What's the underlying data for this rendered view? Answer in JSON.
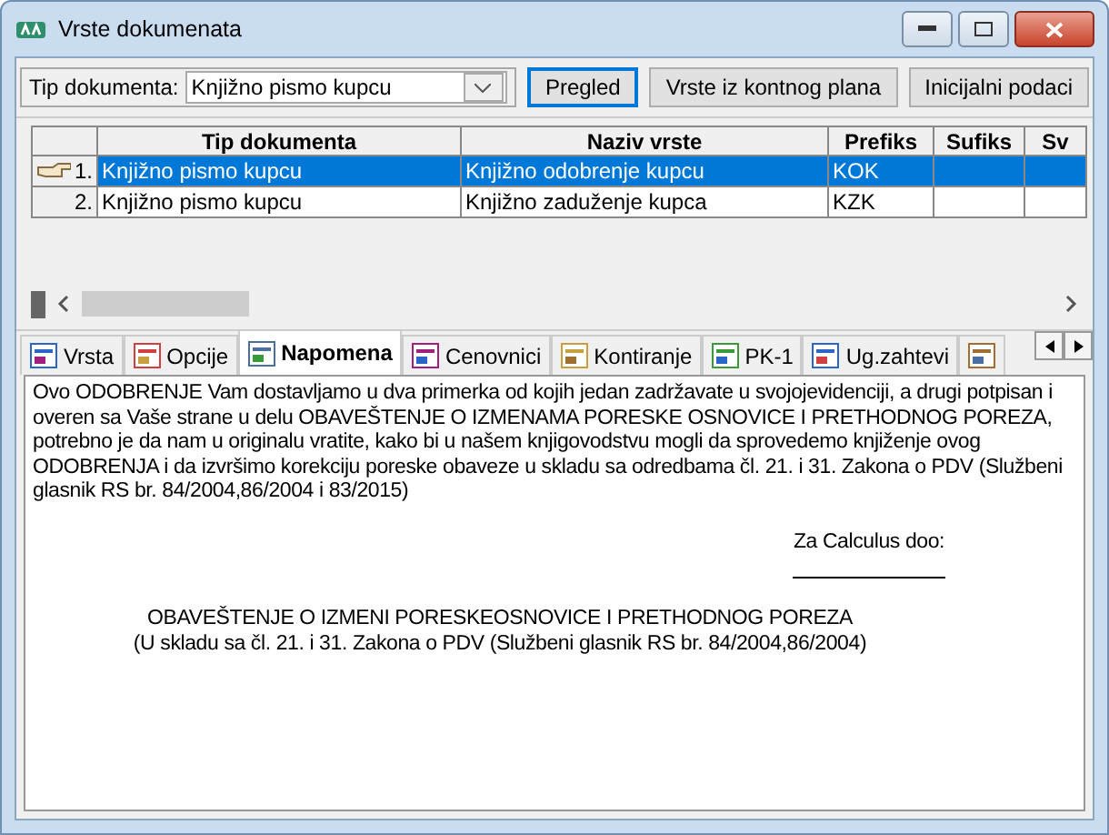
{
  "window": {
    "title": "Vrste dokumenata"
  },
  "toolbar": {
    "filter_label": "Tip dokumenta:",
    "filter_value": "Knjižno pismo kupcu",
    "buttons": [
      {
        "label": "Pregled",
        "selected": true
      },
      {
        "label": "Vrste iz kontnog plana",
        "selected": false
      },
      {
        "label": "Inicijalni podaci",
        "selected": false
      }
    ]
  },
  "table": {
    "columns": [
      "Tip dokumenta",
      "Naziv vrste",
      "Prefiks",
      "Sufiks",
      "Sv"
    ],
    "rows": [
      {
        "number": "1.",
        "selected": true,
        "cells": [
          "Knjižno pismo kupcu",
          "Knjižno odobrenje kupcu",
          "KOK",
          "",
          ""
        ]
      },
      {
        "number": "2.",
        "selected": false,
        "cells": [
          "Knjižno pismo kupcu",
          "Knjižno zaduženje kupca",
          "KZK",
          "",
          ""
        ]
      }
    ]
  },
  "tabs": [
    {
      "label": "Vrsta",
      "selected": false
    },
    {
      "label": "Opcije",
      "selected": false
    },
    {
      "label": "Napomena",
      "selected": true
    },
    {
      "label": "Cenovnici",
      "selected": false
    },
    {
      "label": "Kontiranje",
      "selected": false
    },
    {
      "label": "PK-1",
      "selected": false
    },
    {
      "label": "Ug.zahtevi",
      "selected": false
    },
    {
      "selected": false
    }
  ],
  "note": {
    "paragraph": "Ovo ODOBRENJE Vam dostavljamo u dva primerka od kojih jedan zadržavate u svojojevidenciji, a drugi potpisan i overen sa Vaše strane u delu OBAVEŠTENJE O IZMENAMA PORESKE OSNOVICE I PRETHODNOG POREZA, potrebno je da nam u originalu vratite, kako bi u našem knjigovodstvu mogli da sprovedemo knjiženje ovog ODOBRENJA i da izvršimo korekciju poreske obaveze u skladu sa odredbama čl. 21. i 31. Zakona o PDV (Službeni glasnik RS br. 84/2004,86/2004 i 83/2015)",
    "signature": "Za Calculus doo:",
    "heading": "OBAVEŠTENJE O IZMENI PORESKEOSNOVICE I PRETHODNOG POREZA",
    "subheading": "(U skladu sa čl. 21. i 31. Zakona o PDV (Službeni glasnik RS br. 84/2004,86/2004)"
  }
}
